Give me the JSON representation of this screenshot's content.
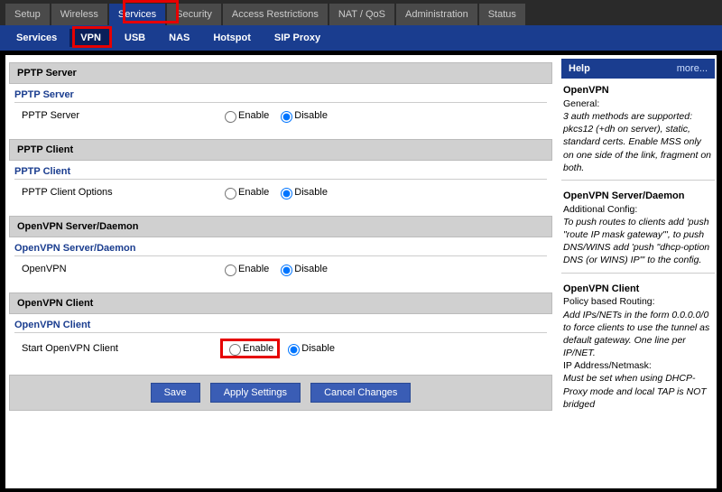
{
  "top_tabs": [
    "Setup",
    "Wireless",
    "Services",
    "Security",
    "Access Restrictions",
    "NAT / QoS",
    "Administration",
    "Status"
  ],
  "active_top": "Services",
  "sub_tabs": [
    "Services",
    "VPN",
    "USB",
    "NAS",
    "Hotspot",
    "SIP Proxy"
  ],
  "active_sub": "VPN",
  "sections": {
    "pptp_server": {
      "header": "PPTP Server",
      "sub": "PPTP Server",
      "label": "PPTP Server"
    },
    "pptp_client": {
      "header": "PPTP Client",
      "sub": "PPTP Client",
      "label": "PPTP Client Options"
    },
    "ovpn_server": {
      "header": "OpenVPN Server/Daemon",
      "sub": "OpenVPN Server/Daemon",
      "label": "OpenVPN"
    },
    "ovpn_client": {
      "header": "OpenVPN Client",
      "sub": "OpenVPN Client",
      "label": "Start OpenVPN Client"
    }
  },
  "opts": {
    "enable": "Enable",
    "disable": "Disable"
  },
  "buttons": {
    "save": "Save",
    "apply": "Apply Settings",
    "cancel": "Cancel Changes"
  },
  "help": {
    "title": "Help",
    "more": "more...",
    "b1t": "OpenVPN",
    "b1s": "General:",
    "b1i": "3 auth methods are supported: pkcs12 (+dh on server), static, standard certs. Enable MSS only on one side of the link, fragment on both.",
    "b2t": "OpenVPN Server/Daemon",
    "b2s": "Additional Config:",
    "b2i": "To push routes to clients add 'push \"route IP mask gateway\"', to push DNS/WINS add 'push \"dhcp-option DNS (or WINS) IP\"' to the config.",
    "b3t": "OpenVPN Client",
    "b3s": "Policy based Routing:",
    "b3i": "Add IPs/NETs in the form 0.0.0.0/0 to force clients to use the tunnel as default gateway. One line per IP/NET.",
    "b3s2": "IP Address/Netmask:",
    "b3i2": "Must be set when using DHCP-Proxy mode and local TAP is NOT bridged"
  }
}
